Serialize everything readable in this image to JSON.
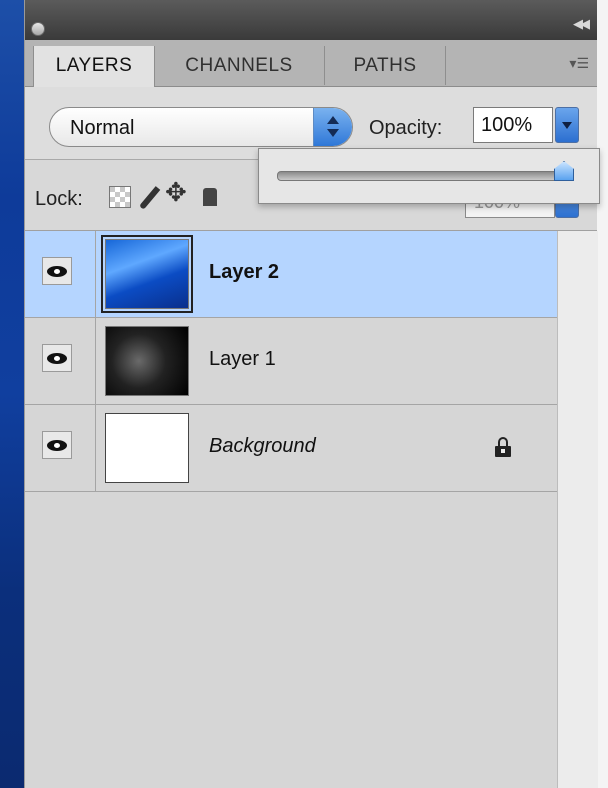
{
  "tabs": [
    {
      "label": "LAYERS",
      "active": true
    },
    {
      "label": "CHANNELS",
      "active": false
    },
    {
      "label": "PATHS",
      "active": false
    }
  ],
  "blend": {
    "mode": "Normal",
    "opacity_label": "Opacity:",
    "opacity_value": "100%",
    "opacity_slider_fraction": 1.0
  },
  "lock": {
    "label": "Lock:",
    "fill_value": "100%"
  },
  "layers": [
    {
      "name": "Layer 2",
      "selected": true,
      "visible": true,
      "thumbnail": "blue-image"
    },
    {
      "name": "Layer 1",
      "selected": false,
      "visible": true,
      "thumbnail": "dark-image"
    },
    {
      "name": "Background",
      "selected": false,
      "visible": true,
      "thumbnail": "white",
      "locked": true
    }
  ],
  "colors": {
    "selection": "#b5d5ff",
    "panel_bg": "#d6d6d6",
    "accent": "#2c6fd0"
  },
  "icons": [
    "close-icon",
    "collapse-icon",
    "panel-menu-icon",
    "stepper-icon",
    "dropdown-arrow-icon",
    "lock-transparent-icon",
    "lock-brush-icon",
    "lock-move-icon",
    "lock-all-icon",
    "eye-icon",
    "lock-icon"
  ]
}
